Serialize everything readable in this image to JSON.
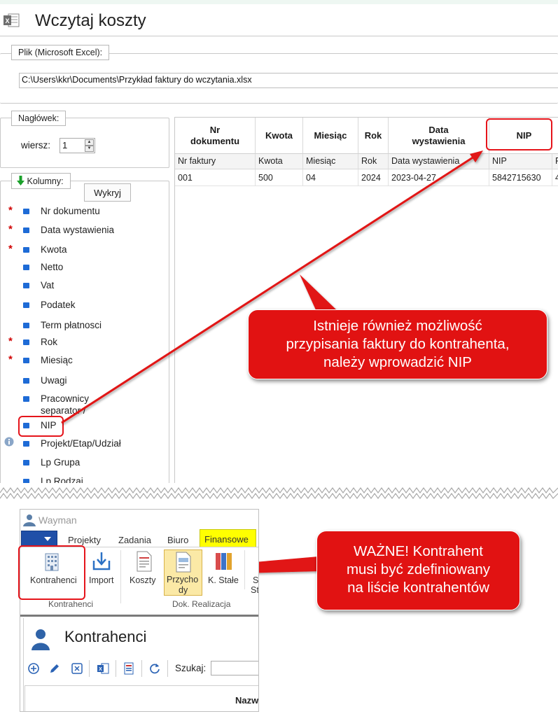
{
  "window": {
    "title": "Wczytaj koszty"
  },
  "file_group": {
    "legend": "Plik (Microsoft Excel):",
    "path": "C:\\Users\\kkr\\Documents\\Przykład faktury do wczytania.xlsx"
  },
  "header_group": {
    "legend": "Nagłówek:",
    "row_label": "wiersz:",
    "row_value": "1"
  },
  "columns_group": {
    "legend": "Kolumny:",
    "detect_button": "Wykryj",
    "items": [
      {
        "label": "Nr dokumentu",
        "required": true
      },
      {
        "label": "Data wystawienia",
        "required": true
      },
      {
        "label": "Kwota",
        "required": true
      },
      {
        "label": "Netto",
        "required": false
      },
      {
        "label": "Vat",
        "required": false
      },
      {
        "label": "Podatek",
        "required": false
      },
      {
        "label": "Term płatnosci",
        "required": false
      },
      {
        "label": "Rok",
        "required": true
      },
      {
        "label": "Miesiąc",
        "required": true
      },
      {
        "label": "Uwagi",
        "required": false
      },
      {
        "label": "Pracownicy",
        "label_line2": "separator /",
        "required": false
      },
      {
        "label": "NIP",
        "required": false
      },
      {
        "label": "Projekt/Etap/Udział",
        "required": false,
        "info_icon": true
      },
      {
        "label": "Lp Grupa",
        "required": false
      },
      {
        "label": "Lp Rodzaj",
        "required": false
      }
    ]
  },
  "mapping_table": {
    "headers": [
      {
        "line1": "Nr",
        "line2": "dokumentu"
      },
      {
        "line1": "Kwota",
        "line2": ""
      },
      {
        "line1": "Miesiąc",
        "line2": ""
      },
      {
        "line1": "Rok",
        "line2": ""
      },
      {
        "line1": "Data",
        "line2": "wystawienia"
      },
      {
        "line1": "NIP",
        "line2": ""
      }
    ],
    "source_headers": [
      "Nr faktury",
      "Kwota",
      "Miesiąc",
      "Rok",
      "Data wystawienia",
      "NIP",
      "P"
    ],
    "rows": [
      [
        "001",
        "500",
        "04",
        "2024",
        "2023-04-27",
        "5842715630",
        "4"
      ]
    ]
  },
  "callouts": {
    "nip": [
      "Istnieje również możliwość",
      "przypisania faktury do kontrahenta,",
      "należy wprowadzić NIP"
    ],
    "important": [
      "WAŻNE! Kontrahent",
      "musi być zdefiniowany",
      "na liście kontrahentów"
    ]
  },
  "app": {
    "name": "Wayman",
    "tabs": [
      "Projekty",
      "Zadania",
      "Biuro",
      "Finansowe"
    ],
    "active_tab": "Finansowe",
    "ribbon_buttons": [
      "Kontrahenci",
      "Import",
      "Koszty",
      "Przycho",
      "dy",
      "K. Stałe",
      "S",
      "St"
    ],
    "ribbon_groups": [
      "Kontrahenci",
      "Dok. Realizacja"
    ],
    "panel_title": "Kontrahenci",
    "search_label": "Szukaj:",
    "column_header": "Nazw"
  },
  "colors": {
    "callout_red": "#e11212",
    "highlight_red": "#e5141b",
    "active_tab_yellow": "#ffff00",
    "required_star": "#d10000",
    "bullet_blue": "#1e6bd6"
  }
}
